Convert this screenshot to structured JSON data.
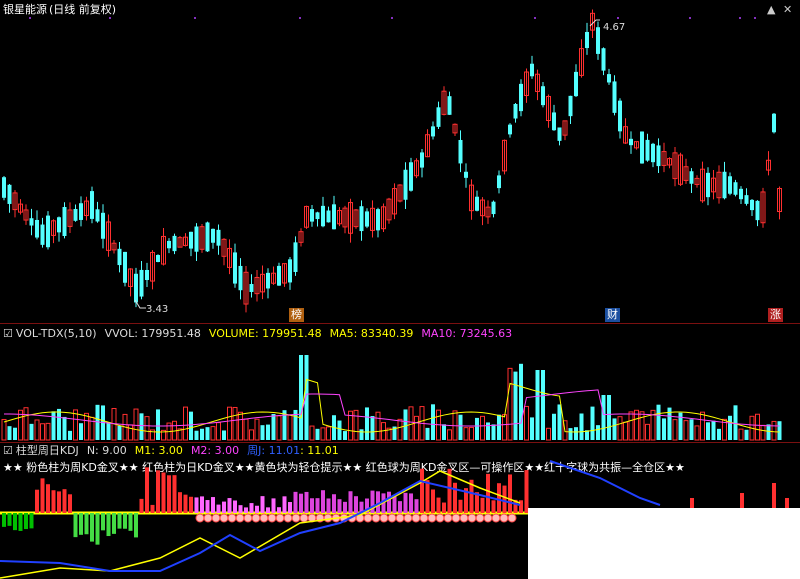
{
  "header": {
    "title": "银星能源",
    "mode": "(日线 前复权)"
  },
  "price_panel": {
    "high_label": "4.67",
    "low_label": "3.43",
    "event_tags": [
      "榜",
      "财",
      "涨"
    ],
    "colors": {
      "up": "#ff3030",
      "down": "#54ffff",
      "ma": "#ffffff"
    }
  },
  "vol_panel": {
    "name": "VOL-TDX(5,10)",
    "vvol": "VVOL: 179951.48",
    "volume": "VOLUME: 179951.48",
    "ma5": "MA5: 83340.39",
    "ma10": "MA10: 73245.63",
    "colors": {
      "volume": "#ffff00",
      "ma5": "#ffff00",
      "ma10": "#ff00ff"
    }
  },
  "kdj_panel": {
    "name": "柱型周日KDJ",
    "n": "N: 9.00",
    "m1": "M1: 3.00",
    "m2": "M2: 3.00",
    "extra": "周J: 11.01",
    "extra2": ": 11.01",
    "legend": "★★ 粉色柱为周KD金叉★★ 红色柱为日KD金叉★★黄色块为轻仓提示★★ 红色球为周KD金叉区—可操作区★★红十字球为共振—全仓区★★"
  },
  "chart_data": [
    {
      "type": "candlestick",
      "title": "银星能源 (日线 前复权)",
      "annotations": {
        "high": 4.67,
        "low": 3.43
      },
      "ylim": [
        3.3,
        4.8
      ]
    },
    {
      "type": "bar",
      "title": "VOL-TDX(5,10)",
      "series": [
        {
          "name": "VOLUME",
          "last": 179951.48
        },
        {
          "name": "MA5",
          "last": 83340.39
        },
        {
          "name": "MA10",
          "last": 73245.63
        }
      ]
    },
    {
      "type": "bar",
      "title": "柱型周日KDJ",
      "params": {
        "N": 9.0,
        "M1": 3.0,
        "M2": 3.0
      }
    }
  ]
}
